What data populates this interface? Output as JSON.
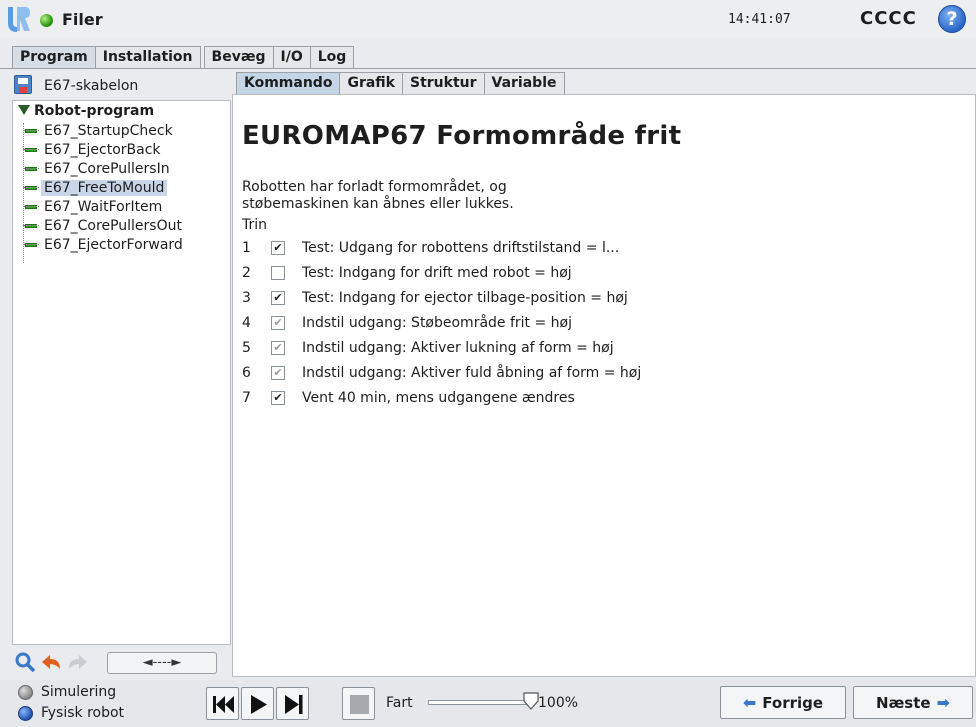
{
  "header": {
    "app_title": "Filer",
    "clock": "14:41:07",
    "robot_name": "CCCC",
    "help_label": "?"
  },
  "main_tabs": [
    {
      "label": "Program",
      "active": true
    },
    {
      "label": "Installation",
      "active": false
    },
    {
      "label": "Bevæg",
      "active": false
    },
    {
      "label": "I/O",
      "active": false
    },
    {
      "label": "Log",
      "active": false
    }
  ],
  "left_panel": {
    "file_name": "E67-skabelon",
    "tree_root": "Robot-program",
    "tree_items": [
      {
        "label": "E67_StartupCheck",
        "selected": false
      },
      {
        "label": "E67_EjectorBack",
        "selected": false
      },
      {
        "label": "E67_CorePullersIn",
        "selected": false
      },
      {
        "label": "E67_FreeToMould",
        "selected": true
      },
      {
        "label": "E67_WaitForItem",
        "selected": false
      },
      {
        "label": "E67_CorePullersOut",
        "selected": false
      },
      {
        "label": "E67_EjectorForward",
        "selected": false
      }
    ],
    "move_label": "◄----►"
  },
  "sub_tabs": [
    {
      "label": "Kommando",
      "active": true
    },
    {
      "label": "Grafik",
      "active": false
    },
    {
      "label": "Struktur",
      "active": false
    },
    {
      "label": "Variable",
      "active": false
    }
  ],
  "command": {
    "heading": "EUROMAP67 Formområde frit",
    "description_line1": "Robotten har forladt formområdet, og",
    "description_line2": "støbemaskinen kan åbnes eller lukkes.",
    "trin_label": "Trin",
    "steps": [
      {
        "num": "1",
        "checked": true,
        "enabled": true,
        "text": "Test: Udgang for robottens driftstilstand = l..."
      },
      {
        "num": "2",
        "checked": false,
        "enabled": true,
        "text": "Test: Indgang for drift med robot = høj"
      },
      {
        "num": "3",
        "checked": true,
        "enabled": true,
        "text": "Test: Indgang for ejector tilbage-position = høj"
      },
      {
        "num": "4",
        "checked": true,
        "enabled": false,
        "text": "Indstil udgang: Støbeområde frit = høj"
      },
      {
        "num": "5",
        "checked": true,
        "enabled": false,
        "text": "Indstil udgang: Aktiver lukning af form = høj"
      },
      {
        "num": "6",
        "checked": true,
        "enabled": false,
        "text": "Indstil udgang: Aktiver fuld åbning af form = høj"
      },
      {
        "num": "7",
        "checked": true,
        "enabled": true,
        "text": "Vent 40 min, mens udgangene ændres"
      }
    ]
  },
  "bottom": {
    "mode_sim": "Simulering",
    "mode_real": "Fysisk robot",
    "speed_label": "Fart",
    "speed_value": "100%",
    "speed_fraction": 1.0,
    "prev_label": "Forrige",
    "next_label": "Næste"
  },
  "colors": {
    "selected_bg": "#c8d6e8",
    "active_tab_bg": "#c4d5e6",
    "tree_item_bar": "#2eaa1a",
    "nav_arrow": "#3a78c8"
  }
}
